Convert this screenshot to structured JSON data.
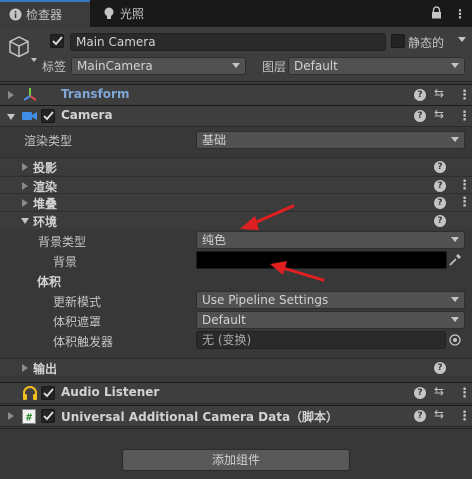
{
  "tabs": [
    {
      "label": "检查器",
      "icon": "info-icon"
    },
    {
      "label": "光照",
      "icon": "bulb-icon"
    }
  ],
  "header": {
    "name": "Main Camera",
    "static_label": "静态的",
    "tag_label": "标签",
    "tag_value": "MainCamera",
    "layer_label": "图层",
    "layer_value": "Default"
  },
  "transform": {
    "title": "Transform"
  },
  "camera": {
    "title": "Camera",
    "render_type_label": "渲染类型",
    "render_type_value": "基础",
    "sections": {
      "projection": "投影",
      "rendering": "渲染",
      "stack": "堆叠",
      "environment": "环境",
      "output": "输出"
    },
    "background_type_label": "背景类型",
    "background_type_value": "纯色",
    "background_label": "背景",
    "background_color": "#000000",
    "volumes_label": "体积",
    "update_mode_label": "更新模式",
    "update_mode_value": "Use Pipeline Settings",
    "volume_mask_label": "体积遮罩",
    "volume_mask_value": "Default",
    "volume_trigger_label": "体积触发器",
    "volume_trigger_value": "无 (变换)"
  },
  "audio_listener": {
    "title": "Audio Listener"
  },
  "urp_data": {
    "title": "Universal Additional Camera Data（脚本）"
  },
  "add_component_label": "添加组件",
  "colors": {
    "accent": "#3a79bb",
    "annotation_red": "#e02020",
    "transform_title": "#7fa6d9"
  }
}
